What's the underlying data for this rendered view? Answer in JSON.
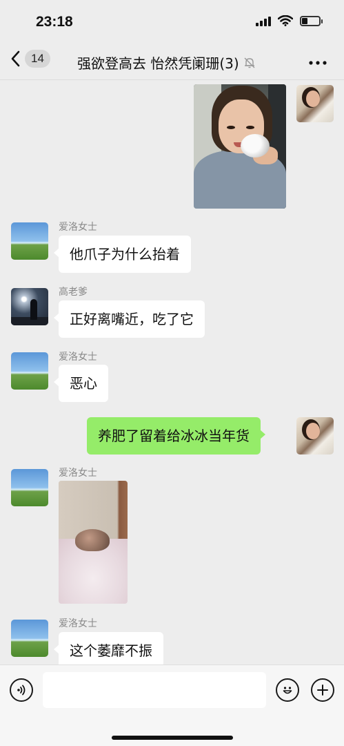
{
  "status_bar": {
    "time": "23:18",
    "icons": [
      "cellular-signal-icon",
      "wifi-icon",
      "battery-icon"
    ],
    "battery_level": 0.35
  },
  "nav": {
    "unread_count": "14",
    "title": "强欲登高去 怡然凭阑珊(3)",
    "icons": [
      "back-chevron-icon",
      "mute-bell-icon",
      "more-icon"
    ]
  },
  "messages": [
    {
      "type": "image",
      "side": "right",
      "sender": "me",
      "content": "photo-girl-with-hamster"
    },
    {
      "type": "text",
      "side": "left",
      "sender": "爱洛女士",
      "text": "他爪子为什么抬着"
    },
    {
      "type": "text",
      "side": "left",
      "sender": "高老爹",
      "text": "正好离嘴近，吃了它"
    },
    {
      "type": "text",
      "side": "left",
      "sender": "爱洛女士",
      "text": "恶心"
    },
    {
      "type": "text",
      "side": "right",
      "sender": "me",
      "text": "养肥了留着给冰冰当年货"
    },
    {
      "type": "image",
      "side": "left",
      "sender": "爱洛女士",
      "content": "photo-pet-on-bed"
    },
    {
      "type": "text",
      "side": "left",
      "sender": "爱洛女士",
      "text": "这个萎靡不振"
    }
  ],
  "input_bar": {
    "value": "",
    "icons": [
      "voice-icon",
      "emoji-icon",
      "plus-icon"
    ]
  },
  "colors": {
    "background": "#ededed",
    "bubble_self": "#95ec69",
    "bubble_other": "#ffffff",
    "sender_name": "#888888"
  }
}
